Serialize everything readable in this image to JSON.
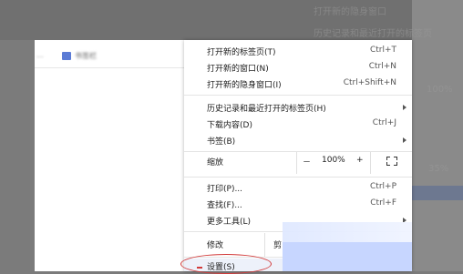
{
  "background": {
    "top_right_text_1": "打开新的隐身窗口",
    "top_right_text_2": "历史记录和最近打开的标签页",
    "zoom_ghost": "100%",
    "ghost_right": "35%"
  },
  "bookmarks_bar": {
    "left_text": "...",
    "item_label": "书签栏"
  },
  "menu": {
    "items": [
      {
        "label": "打开新的标签页(T)",
        "shortcut": "Ctrl+T"
      },
      {
        "label": "打开新的窗口(N)",
        "shortcut": "Ctrl+N"
      },
      {
        "label": "打开新的隐身窗口(I)",
        "shortcut": "Ctrl+Shift+N"
      },
      {
        "label": "历史记录和最近打开的标签页(H)",
        "shortcut": ""
      },
      {
        "label": "下载内容(D)",
        "shortcut": "Ctrl+J"
      },
      {
        "label": "书签(B)",
        "shortcut": ""
      },
      {
        "label": "打印(P)...",
        "shortcut": "Ctrl+P"
      },
      {
        "label": "查找(F)...",
        "shortcut": "Ctrl+F"
      },
      {
        "label": "更多工具(L)",
        "shortcut": ""
      },
      {
        "label": "设置(S)",
        "shortcut": ""
      }
    ],
    "zoom": {
      "label": "缩放",
      "minus": "－",
      "value": "100%",
      "plus": "+"
    },
    "edit": {
      "label": "修改",
      "cut": "剪"
    }
  },
  "colors": {
    "highlight_circle": "#d23a3a",
    "menu_bg": "#ffffff",
    "dim_bg": "#7b7b7b"
  }
}
